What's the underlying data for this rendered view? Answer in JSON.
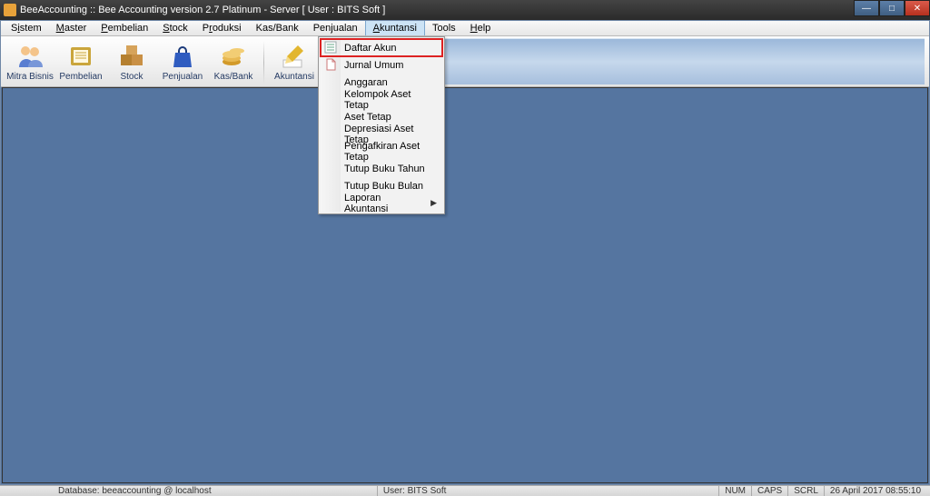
{
  "title": "BeeAccounting :: Bee Accounting version 2.7 Platinum - Server  [ User : BITS Soft ]",
  "menubar": {
    "items": [
      {
        "label": "Sistem",
        "u": "i"
      },
      {
        "label": "Master",
        "u": "M"
      },
      {
        "label": "Pembelian",
        "u": "P"
      },
      {
        "label": "Stock",
        "u": "S"
      },
      {
        "label": "Produksi",
        "u": "r"
      },
      {
        "label": "Kas/Bank",
        "u": ""
      },
      {
        "label": "Penjualan",
        "u": ""
      },
      {
        "label": "Akuntansi",
        "u": "A"
      },
      {
        "label": "Tools",
        "u": ""
      },
      {
        "label": "Help",
        "u": "H"
      }
    ],
    "active_index": 7
  },
  "toolbar": {
    "buttons": [
      {
        "label": "Mitra Bisnis",
        "icon": "people-icon",
        "color": "#5a7ed1"
      },
      {
        "label": "Pembelian",
        "icon": "book-icon",
        "color": "#caa53b"
      },
      {
        "label": "Stock",
        "icon": "boxes-icon",
        "color": "#b58030"
      },
      {
        "label": "Penjualan",
        "icon": "bag-icon",
        "color": "#2f5cc0"
      },
      {
        "label": "Kas/Bank",
        "icon": "coins-icon",
        "color": "#d29a2a"
      },
      {
        "label": "Akuntansi",
        "icon": "pencil-icon",
        "color": "#e2b62f"
      }
    ]
  },
  "dropdown": {
    "highlight_index": 0,
    "items": [
      {
        "label": "Daftar Akun",
        "icon": "list-icon"
      },
      {
        "label": "Jurnal Umum",
        "icon": "doc-icon"
      },
      {
        "label": "Anggaran"
      },
      {
        "label": "Kelompok Aset Tetap"
      },
      {
        "label": "Aset Tetap"
      },
      {
        "label": "Depresiasi Aset Tetap"
      },
      {
        "label": "Pengafkiran Aset Tetap"
      },
      {
        "label": "Tutup Buku Tahun"
      },
      {
        "label": "Tutup Buku Bulan"
      },
      {
        "label": "Laporan Akuntansi",
        "submenu": true
      }
    ]
  },
  "status": {
    "db": "Database: beeaccounting @ localhost",
    "user": "User: BITS Soft",
    "num": "NUM",
    "caps": "CAPS",
    "scrl": "SCRL",
    "datetime": "26 April 2017  08:55:10"
  }
}
